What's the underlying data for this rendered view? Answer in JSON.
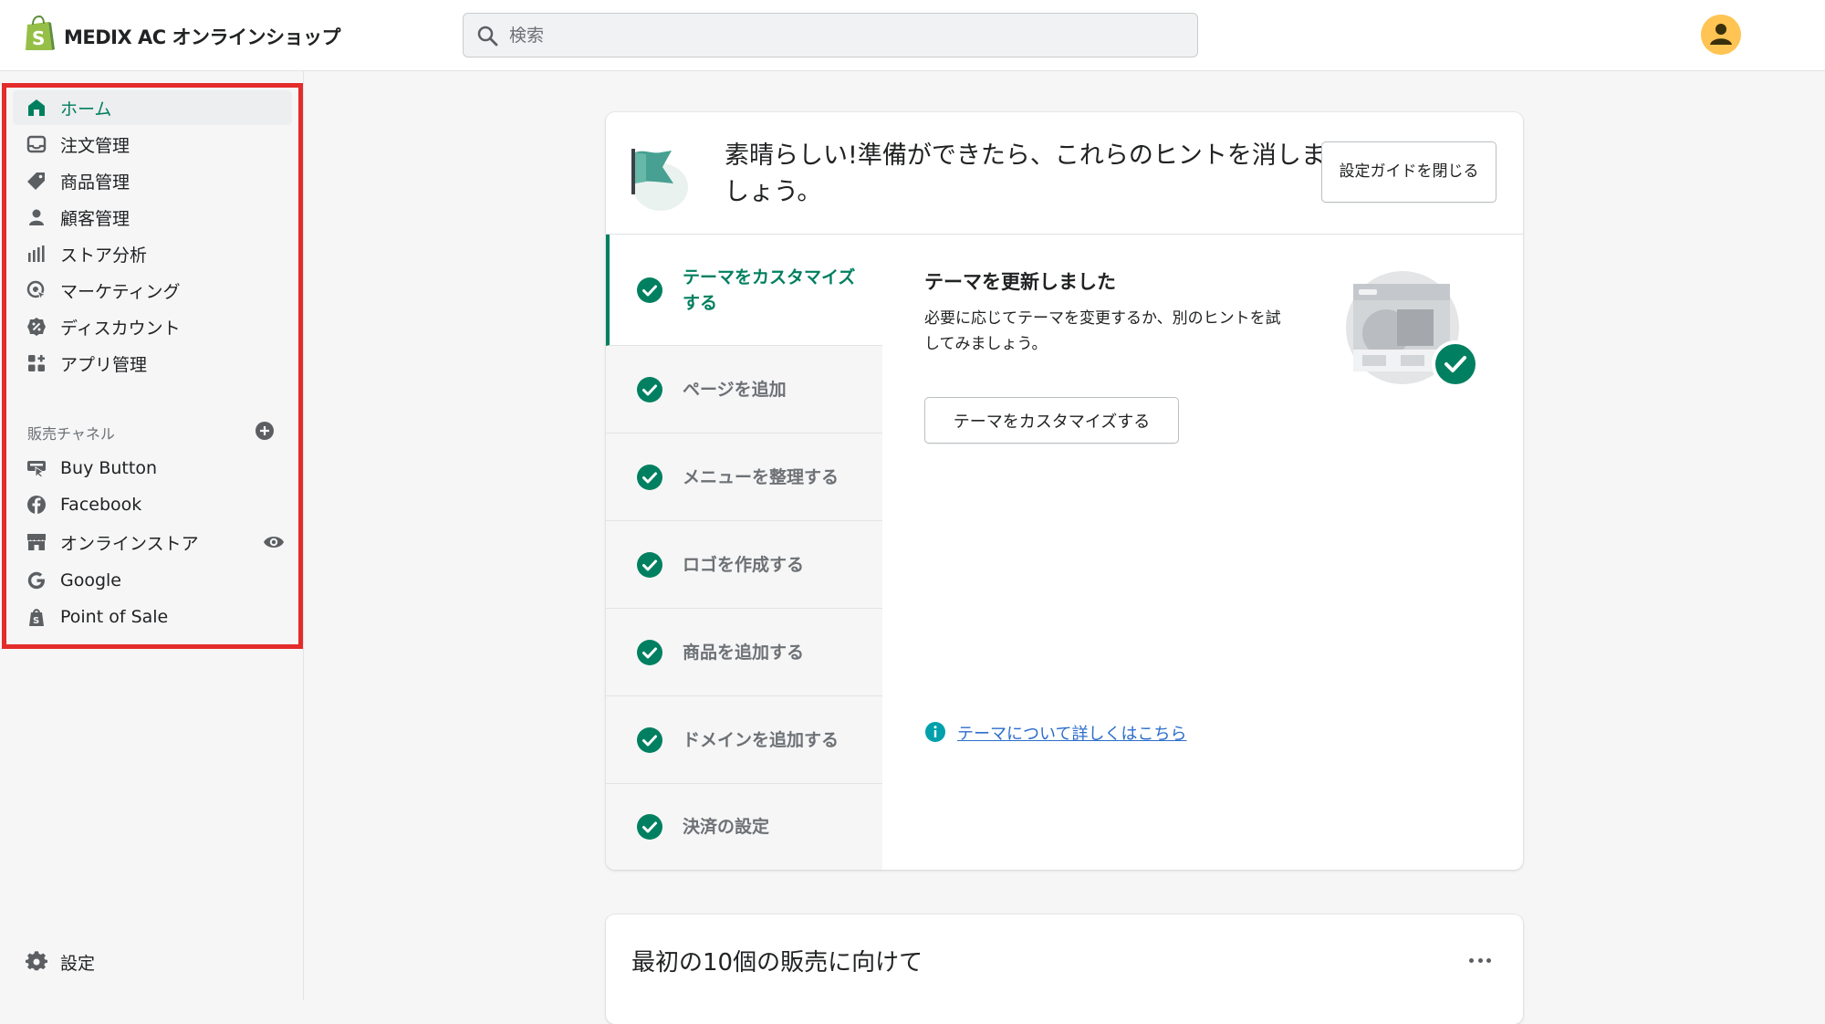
{
  "topbar": {
    "store_name": "MEDIX AC オンラインショップ",
    "search_placeholder": "検索"
  },
  "sidebar": {
    "nav_items": [
      {
        "label": "ホーム",
        "icon": "home-icon",
        "active": true
      },
      {
        "label": "注文管理",
        "icon": "inbox-icon"
      },
      {
        "label": "商品管理",
        "icon": "tag-icon"
      },
      {
        "label": "顧客管理",
        "icon": "person-icon"
      },
      {
        "label": "ストア分析",
        "icon": "bar-chart-icon"
      },
      {
        "label": "マーケティング",
        "icon": "target-icon"
      },
      {
        "label": "ディスカウント",
        "icon": "discount-icon"
      },
      {
        "label": "アプリ管理",
        "icon": "apps-icon"
      }
    ],
    "sales_channels_title": "販売チャネル",
    "channels": [
      {
        "label": "Buy Button",
        "icon": "buy-button-icon"
      },
      {
        "label": "Facebook",
        "icon": "facebook-icon"
      },
      {
        "label": "オンラインストア",
        "icon": "store-icon"
      },
      {
        "label": "Google",
        "icon": "google-icon"
      },
      {
        "label": "Point of Sale",
        "icon": "point-of-sale-icon"
      }
    ],
    "settings_label": "設定"
  },
  "setup_card": {
    "header_text": "素晴らしい!準備ができたら、これらのヒントを消しましょう。",
    "close_button": "設定ガイドを閉じる",
    "steps": [
      {
        "label": "テーマをカスタマイズする",
        "done": true,
        "active": true
      },
      {
        "label": "ページを追加",
        "done": true
      },
      {
        "label": "メニューを整理する",
        "done": true
      },
      {
        "label": "ロゴを作成する",
        "done": true
      },
      {
        "label": "商品を追加する",
        "done": true
      },
      {
        "label": "ドメインを追加する",
        "done": true
      },
      {
        "label": "決済の設定",
        "done": true
      }
    ],
    "detail": {
      "title": "テーマを更新しました",
      "description": "必要に応じてテーマを変更するか、別のヒントを試してみましょう。",
      "button": "テーマをカスタマイズする",
      "learn_more": "テーマについて詳しくはこちら"
    }
  },
  "second_card": {
    "title": "最初の10個の販売に向けて"
  },
  "colors": {
    "accent_green": "#008060",
    "highlight_red": "#e32c2b",
    "link_blue": "#2c6ecb",
    "avatar_yellow": "#ffc453"
  }
}
